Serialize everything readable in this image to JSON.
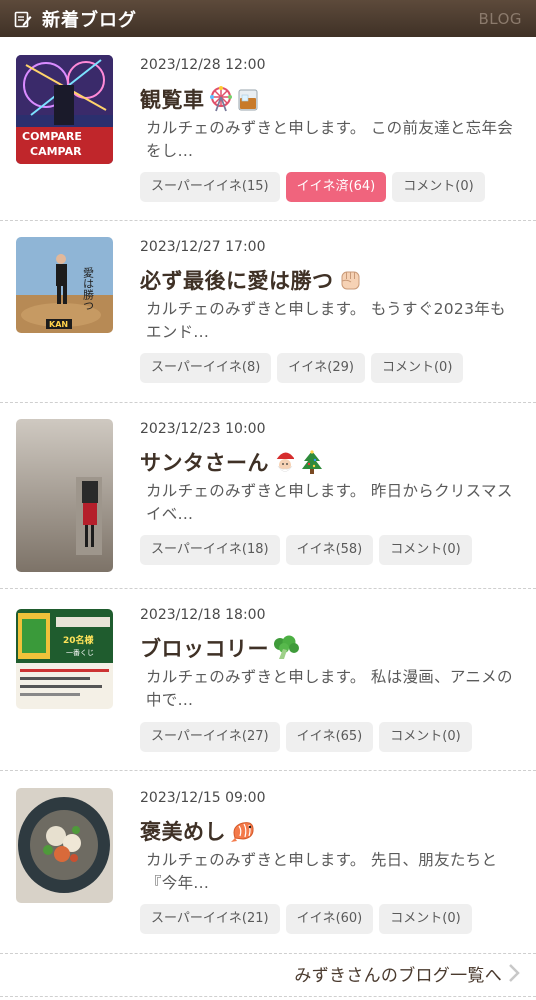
{
  "header": {
    "title": "新着ブログ",
    "right_label": "BLOG"
  },
  "entries": [
    {
      "date": "2023/12/28 12:00",
      "title": "観覧車",
      "emoji": [
        "ferris-wheel",
        "whisky-glass"
      ],
      "excerpt": "カルチェのみずきと申します。 この前友達と忘年会をし...",
      "super_iine": "スーパーイイネ(15)",
      "iine": "イイネ済(64)",
      "iine_active": true,
      "comment": "コメント(0)",
      "thumb_text": [
        "COMPARE",
        "CAMPAR"
      ]
    },
    {
      "date": "2023/12/27 17:00",
      "title": "必ず最後に愛は勝つ",
      "emoji": [
        "raised-fist"
      ],
      "excerpt": "カルチェのみずきと申します。 もうすぐ2023年もエンド...",
      "super_iine": "スーパーイイネ(8)",
      "iine": "イイネ(29)",
      "iine_active": false,
      "comment": "コメント(0)",
      "thumb_text": [
        "愛は勝つ",
        "KAN"
      ]
    },
    {
      "date": "2023/12/23 10:00",
      "title": "サンタさーん",
      "emoji": [
        "santa",
        "christmas-tree"
      ],
      "excerpt": "カルチェのみずきと申します。 昨日からクリスマスイベ...",
      "super_iine": "スーパーイイネ(18)",
      "iine": "イイネ(58)",
      "iine_active": false,
      "comment": "コメント(0)"
    },
    {
      "date": "2023/12/18 18:00",
      "title": "ブロッコリー",
      "emoji": [
        "broccoli"
      ],
      "excerpt": "カルチェのみずきと申します。 私は漫画、アニメの中で...",
      "super_iine": "スーパーイイネ(27)",
      "iine": "イイネ(65)",
      "iine_active": false,
      "comment": "コメント(0)",
      "thumb_text": [
        "20名様",
        "一番くじ"
      ]
    },
    {
      "date": "2023/12/15 09:00",
      "title": "褒美めし",
      "emoji": [
        "shrimp"
      ],
      "excerpt": "カルチェのみずきと申します。 先日、朋友たちと 『今年...",
      "super_iine": "スーパーイイネ(21)",
      "iine": "イイネ(60)",
      "iine_active": false,
      "comment": "コメント(0)"
    }
  ],
  "footer": {
    "link_label": "みずきさんのブログ一覧へ"
  },
  "colors": {
    "header_bg": "#4b3b2f",
    "active_like": "#f0647d",
    "button_bg": "#efefef"
  }
}
